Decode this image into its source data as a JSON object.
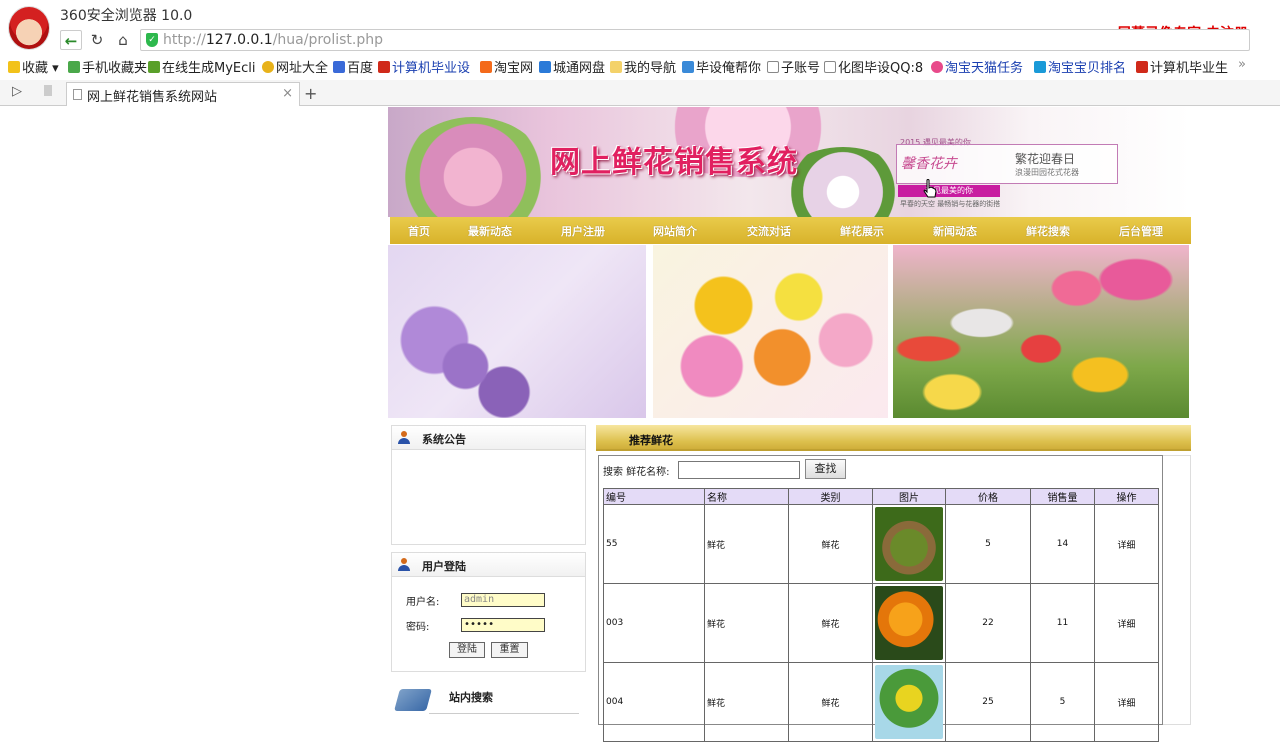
{
  "browser": {
    "app_title": "360安全浏览器 10.0",
    "recorder_watermark": "屏幕录像专家  未注册",
    "url_prefix": "http://",
    "url_host": "127.0.0.1",
    "url_path": "/hua/prolist.php",
    "bookmarks": [
      {
        "label": "收藏",
        "icon": "star-icon"
      },
      {
        "label": "手机收藏夹",
        "icon": "phone-icon"
      },
      {
        "label": "在线生成MyEcli",
        "icon": "puzzle-icon"
      },
      {
        "label": "网址大全",
        "icon": "globe-icon"
      },
      {
        "label": "百度",
        "icon": "baidu-icon"
      },
      {
        "label": "计算机毕业设",
        "icon": "book-icon"
      },
      {
        "label": "淘宝网",
        "icon": "taobao-icon"
      },
      {
        "label": "城通网盘",
        "icon": "cloud-icon"
      },
      {
        "label": "我的导航",
        "icon": "folder-icon"
      },
      {
        "label": "毕设俺帮你",
        "icon": "image-icon"
      },
      {
        "label": "子账号",
        "icon": "page-icon"
      },
      {
        "label": "化图毕设QQ:8",
        "icon": "page-icon"
      },
      {
        "label": "淘宝天猫任务",
        "icon": "flower-icon"
      },
      {
        "label": "淘宝宝贝排名",
        "icon": "taobao-icon"
      },
      {
        "label": "计算机毕业生",
        "icon": "book-icon"
      }
    ],
    "tab_title": "网上鲜花销售系统网站"
  },
  "site": {
    "title": "网上鲜花销售系统",
    "promo": {
      "top": "2015 遇见最美的你",
      "script": "馨香花卉",
      "line1": "繁花迎春日",
      "line2": "浪漫田园花式花器",
      "button": "遇见最美的你",
      "sub": "早春的天空 最畅销与花器的街搭"
    },
    "menu": [
      "首页",
      "最新动态",
      "用户注册",
      "网站简介",
      "交流对话",
      "鲜花展示",
      "新闻动态",
      "鲜花搜索",
      "后台管理"
    ],
    "notice_title": "系统公告",
    "login": {
      "title": "用户登陆",
      "username_label": "用户名:",
      "username_value": "admin",
      "password_label": "密码:",
      "password_value": "•••••",
      "login_btn": "登陆",
      "reset_btn": "重置"
    },
    "site_search_title": "站内搜索",
    "recommend": {
      "title": "推荐鲜花",
      "search_label": "搜索 鲜花名称:",
      "search_btn": "查找",
      "columns": [
        "编号",
        "名称",
        "类别",
        "图片",
        "价格",
        "销售量",
        "操作"
      ],
      "rows": [
        {
          "id": "55",
          "name": "鲜花",
          "category": "鲜花",
          "price": "5",
          "sales": "14",
          "action": "详细"
        },
        {
          "id": "003",
          "name": "鲜花",
          "category": "鲜花",
          "price": "22",
          "sales": "11",
          "action": "详细"
        },
        {
          "id": "004",
          "name": "鲜花",
          "category": "鲜花",
          "price": "25",
          "sales": "5",
          "action": "详细"
        }
      ]
    }
  }
}
